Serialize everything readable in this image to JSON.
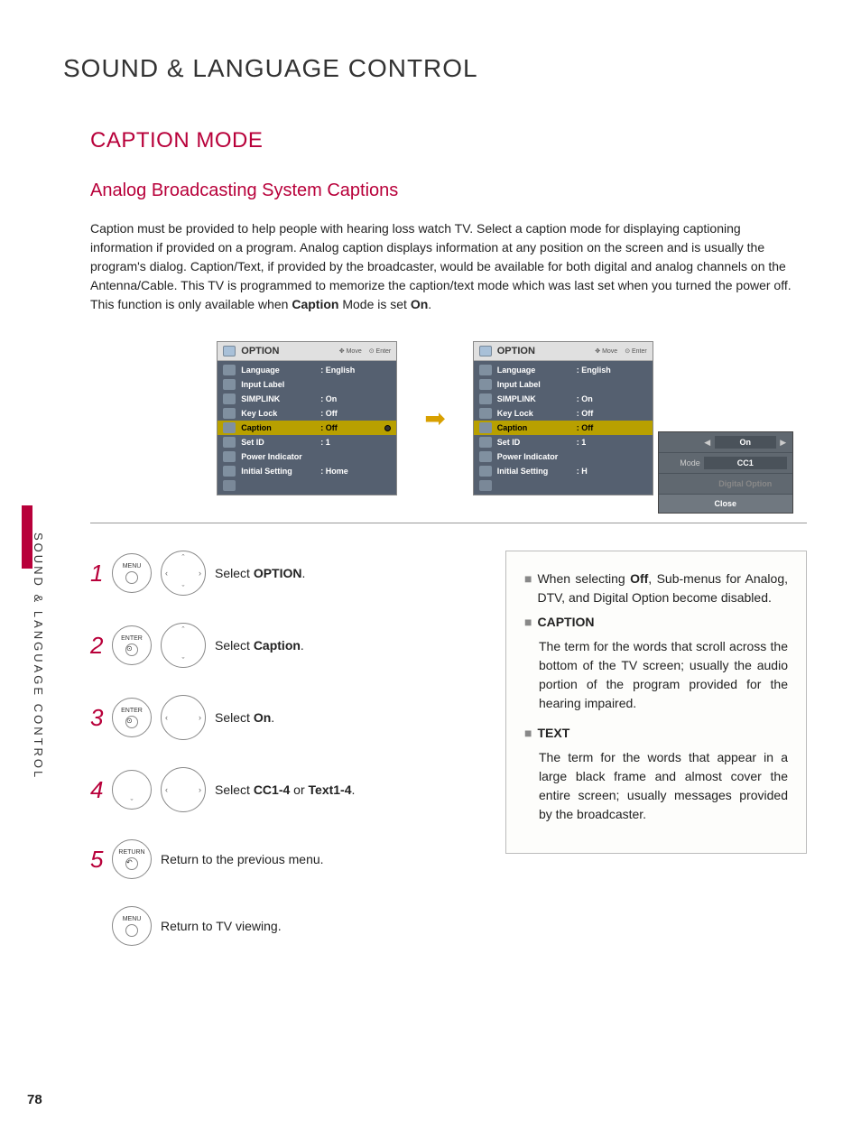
{
  "page_number": "78",
  "side_label": "SOUND & LANGUAGE CONTROL",
  "main_title": "SOUND & LANGUAGE CONTROL",
  "sub_title": "CAPTION MODE",
  "sub_sub": "Analog Broadcasting System Captions",
  "intro_pre": "Caption must be provided to help people with hearing loss watch TV. Select a caption mode for displaying captioning information if provided on a program. Analog caption displays information at any position on the screen and is usually the program's dialog. Caption/Text, if provided by the broadcaster, would be available for both digital and analog channels on the Antenna/Cable. This TV is programmed to memorize the caption/text mode which was last set when you turned the power off. This function is only available when ",
  "intro_bold1": "Caption",
  "intro_mid": " Mode is set ",
  "intro_bold2": "On",
  "intro_end": ".",
  "osd": {
    "title": "OPTION",
    "hint_move": "Move",
    "hint_enter": "Enter",
    "rows": {
      "r0": {
        "label": "Language",
        "value": ": English"
      },
      "r1": {
        "label": "Input Label",
        "value": ""
      },
      "r2": {
        "label": "SIMPLINK",
        "value": ": On"
      },
      "r3": {
        "label": "Key Lock",
        "value": ": Off"
      },
      "r4": {
        "label": "Caption",
        "value": ": Off"
      },
      "r5": {
        "label": "Set ID",
        "value": ": 1"
      },
      "r6": {
        "label": "Power Indicator",
        "value": ""
      },
      "r7": {
        "label": "Initial Setting",
        "value": ": Home"
      }
    }
  },
  "osd2_caption_value": ": Off",
  "popup": {
    "row1_val": "On",
    "row2_lab": "Mode",
    "row2_val": "CC1",
    "row3_val": "Digital Option",
    "close": "Close"
  },
  "steps": {
    "s1_pre": "Select ",
    "s1_bold": "OPTION",
    "s1_post": ".",
    "s2_pre": "Select ",
    "s2_bold": "Caption",
    "s2_post": ".",
    "s3_pre": "Select ",
    "s3_bold": "On",
    "s3_post": ".",
    "s4_pre": "Select ",
    "s4_bold1": "CC1-4",
    "s4_mid": " or ",
    "s4_bold2": "Text1-4",
    "s4_post": ".",
    "s5": "Return to the previous menu.",
    "s6": "Return to TV viewing."
  },
  "btn_menu": "MENU",
  "btn_enter": "ENTER",
  "btn_return": "RETURN",
  "info": {
    "b1_pre": "When selecting ",
    "b1_bold": "Off",
    "b1_post": ", Sub-menus for Analog, DTV, and Digital Option become disabled.",
    "b2_head": "CAPTION",
    "b2_body": "The term for the words that scroll across the bottom of the TV screen; usually the audio portion of the program provided for the hearing impaired.",
    "b3_head": "TEXT",
    "b3_body": "The term for the words that appear in a large black frame and almost cover the entire screen; usually messages provided by the broadcaster."
  }
}
